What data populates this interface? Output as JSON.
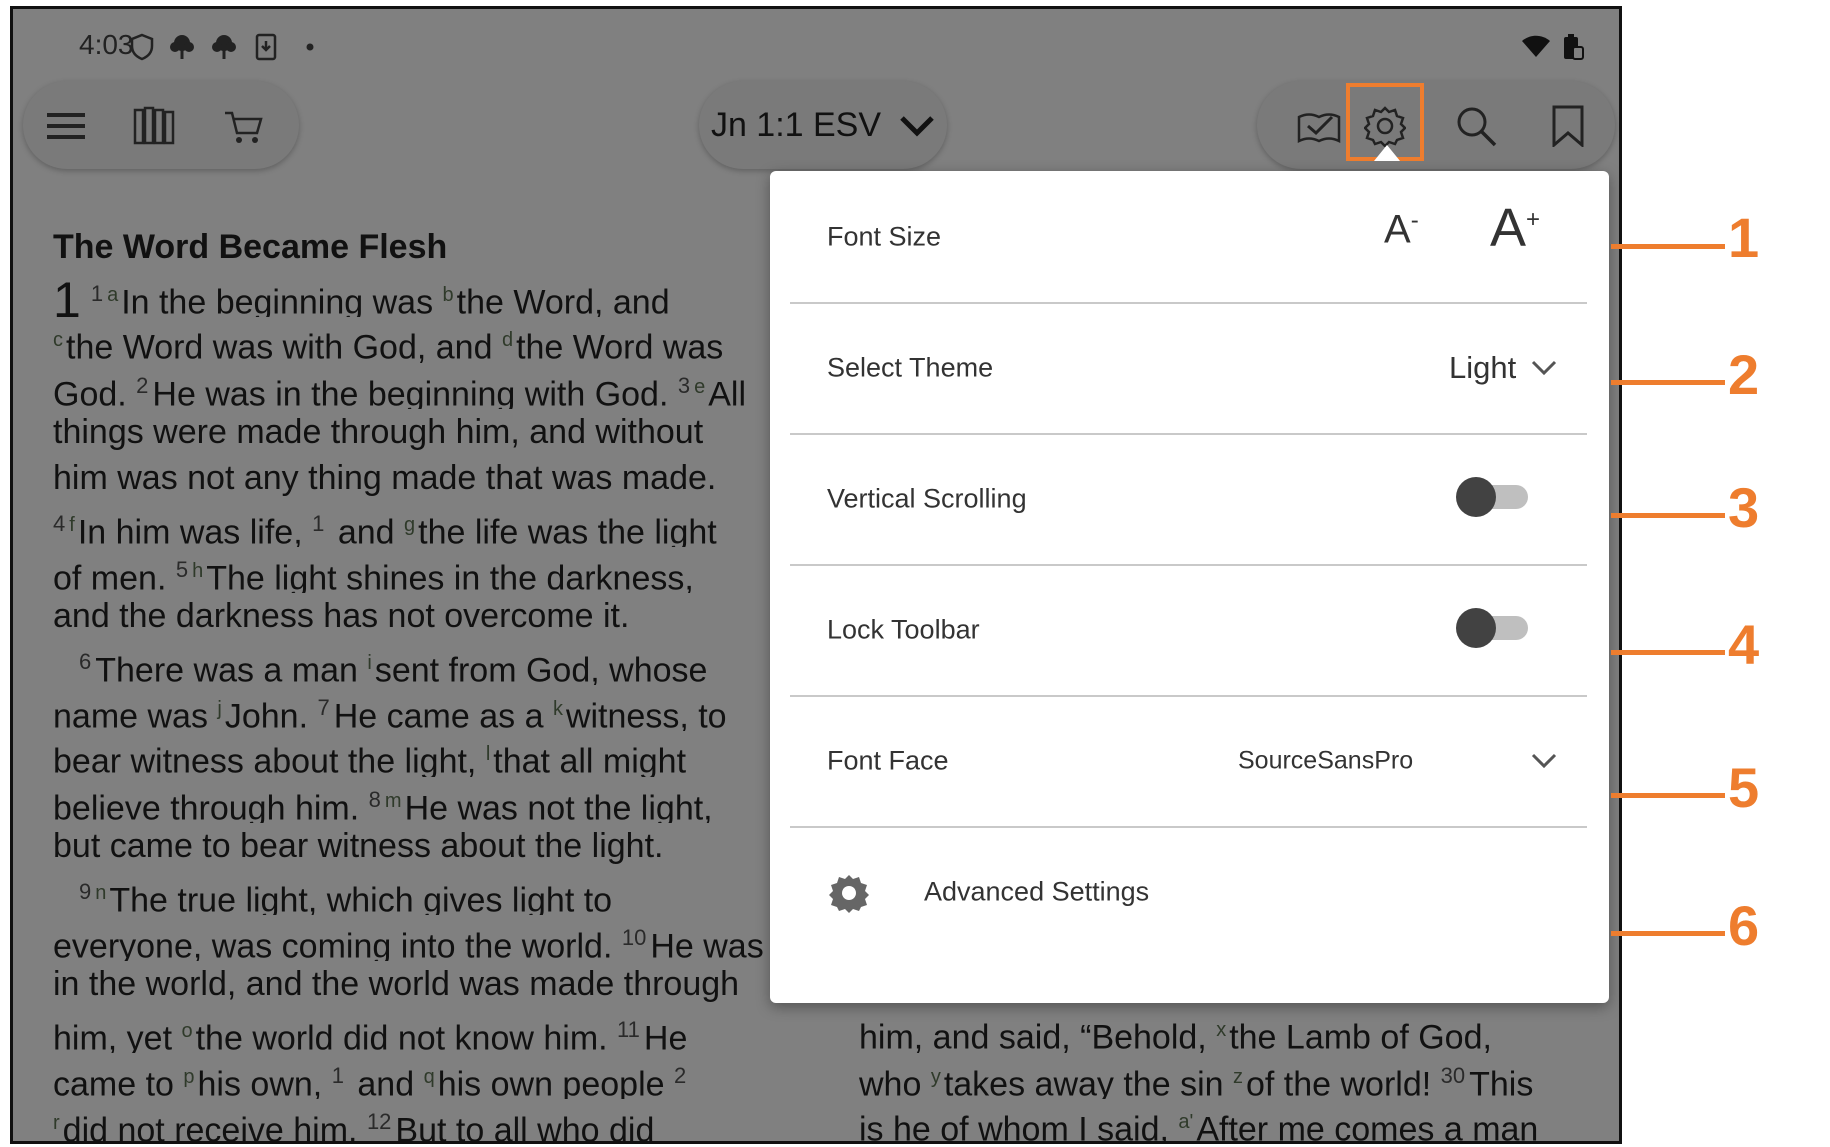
{
  "status_bar": {
    "time": "4:03"
  },
  "toolbar": {
    "reference": "Jn 1:1 ESV"
  },
  "bible": {
    "section_title": "The Word Became Flesh",
    "chapter": "1",
    "left_lines": [
      [
        [
          "v",
          "1"
        ],
        [
          "f",
          "a"
        ],
        [
          "t",
          "In the beginning was "
        ],
        [
          "f",
          "b"
        ],
        [
          "t",
          "the Word, and"
        ]
      ],
      [
        [
          "f",
          "c"
        ],
        [
          "t",
          "the Word was with God, and "
        ],
        [
          "f",
          "d"
        ],
        [
          "t",
          "the Word was"
        ]
      ],
      [
        [
          "t",
          "God. "
        ],
        [
          "v",
          "2"
        ],
        [
          "t",
          "He was in the beginning with God. "
        ],
        [
          "v",
          "3"
        ],
        [
          "f",
          "e"
        ],
        [
          "t",
          "All"
        ]
      ],
      [
        [
          "t",
          "things were made through him, and without"
        ]
      ],
      [
        [
          "t",
          "him was not any thing made that was made."
        ]
      ],
      [
        [
          "v",
          "4"
        ],
        [
          "f",
          "f"
        ],
        [
          "t",
          "In him was life, "
        ],
        [
          "v",
          "1"
        ],
        [
          "t",
          " and "
        ],
        [
          "f",
          "g"
        ],
        [
          "t",
          "the life was the light"
        ]
      ],
      [
        [
          "t",
          "of men. "
        ],
        [
          "v",
          "5"
        ],
        [
          "f",
          "h"
        ],
        [
          "t",
          "The light shines in the darkness,"
        ]
      ],
      [
        [
          "t",
          "and the darkness has not overcome it."
        ]
      ],
      [
        [
          "i",
          ""
        ],
        [
          "v",
          "6"
        ],
        [
          "t",
          "There was a man "
        ],
        [
          "f",
          "i"
        ],
        [
          "t",
          "sent from God, whose"
        ]
      ],
      [
        [
          "t",
          "name was "
        ],
        [
          "f",
          "j"
        ],
        [
          "t",
          "John. "
        ],
        [
          "v",
          "7"
        ],
        [
          "t",
          "He came as a "
        ],
        [
          "f",
          "k"
        ],
        [
          "t",
          "witness, to"
        ]
      ],
      [
        [
          "t",
          "bear witness about the light, "
        ],
        [
          "f",
          "l"
        ],
        [
          "t",
          "that all might"
        ]
      ],
      [
        [
          "t",
          "believe through him. "
        ],
        [
          "v",
          "8"
        ],
        [
          "f",
          "m"
        ],
        [
          "t",
          "He was not the light,"
        ]
      ],
      [
        [
          "t",
          "but came to bear witness about the light."
        ]
      ],
      [
        [
          "i",
          ""
        ],
        [
          "v",
          "9"
        ],
        [
          "f",
          "n"
        ],
        [
          "t",
          "The true light, which gives light to"
        ]
      ],
      [
        [
          "t",
          "everyone, was coming into the world. "
        ],
        [
          "v",
          "10"
        ],
        [
          "t",
          "He was"
        ]
      ],
      [
        [
          "t",
          "in the world, and the world was made through"
        ]
      ],
      [
        [
          "t",
          "him, yet "
        ],
        [
          "f",
          "o"
        ],
        [
          "t",
          "the world did not know him. "
        ],
        [
          "v",
          "11"
        ],
        [
          "t",
          "He"
        ]
      ],
      [
        [
          "t",
          "came to "
        ],
        [
          "f",
          "p"
        ],
        [
          "t",
          "his own, "
        ],
        [
          "v",
          "1"
        ],
        [
          "t",
          " and "
        ],
        [
          "f",
          "q"
        ],
        [
          "t",
          "his own people "
        ],
        [
          "v",
          "2"
        ]
      ],
      [
        [
          "f",
          "r"
        ],
        [
          "t",
          "did not receive him. "
        ],
        [
          "v",
          "12"
        ],
        [
          "t",
          "But to all who did"
        ]
      ]
    ],
    "right_lines": [
      [
        [
          "t",
          "him, and said, “Behold, "
        ],
        [
          "f",
          "x"
        ],
        [
          "t",
          "the Lamb of God,"
        ]
      ],
      [
        [
          "t",
          "who "
        ],
        [
          "f",
          "y"
        ],
        [
          "t",
          "takes away the sin "
        ],
        [
          "f",
          "z"
        ],
        [
          "t",
          "of the world! "
        ],
        [
          "v",
          "30"
        ],
        [
          "t",
          "This"
        ]
      ],
      [
        [
          "t",
          "is he of whom I said, "
        ],
        [
          "f",
          "a'"
        ],
        [
          "t",
          "After me comes a man"
        ]
      ]
    ]
  },
  "settings": {
    "font_size_label": "Font Size",
    "font_decrease": "A",
    "font_decrease_sup": "-",
    "font_increase": "A",
    "font_increase_sup": "+",
    "theme_label": "Select Theme",
    "theme_value": "Light",
    "vertical_scrolling_label": "Vertical Scrolling",
    "vertical_scrolling_on": false,
    "lock_toolbar_label": "Lock Toolbar",
    "lock_toolbar_on": false,
    "font_face_label": "Font Face",
    "font_face_value": "SourceSansPro",
    "advanced_label": "Advanced Settings"
  },
  "callouts": [
    "1",
    "2",
    "3",
    "4",
    "5",
    "6"
  ],
  "colors": {
    "accent": "#ee7d2e",
    "overlay": "#808080",
    "panel": "#ffffff"
  },
  "icons": [
    "shield-icon",
    "tree-icon",
    "download-icon",
    "wifi-icon",
    "battery-icon",
    "menu-icon",
    "library-icon",
    "cart-icon",
    "chevron-down-icon",
    "reading-plan-icon",
    "gear-icon",
    "search-icon",
    "bookmark-icon"
  ]
}
